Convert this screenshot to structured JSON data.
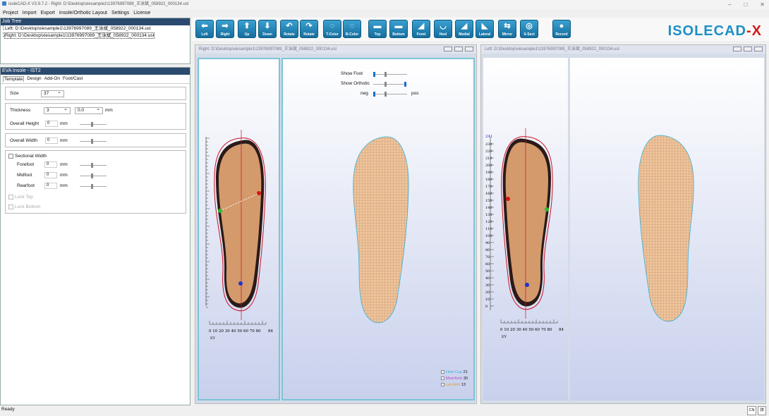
{
  "title": "isoleCAD-X V3.9.7.2 - Right: D:\\Desktop\\xiesample1\\13976997089_王泳斌_058922_000134.usl",
  "menu": [
    "Project",
    "Import",
    "Export",
    "Insole/Orthotic Layout",
    "Settings",
    "License"
  ],
  "toolbar": [
    {
      "label": "Left",
      "icon": "arrow-left-icon",
      "glyph": "⬅"
    },
    {
      "label": "Right",
      "icon": "arrow-right-icon",
      "glyph": "➡"
    },
    {
      "label": "Up",
      "icon": "arrow-up-icon",
      "glyph": "⬆"
    },
    {
      "label": "Down",
      "icon": "arrow-down-icon",
      "glyph": "⬇"
    },
    {
      "label": "Rotate",
      "icon": "rotate-ccw-icon",
      "glyph": "↶"
    },
    {
      "label": "Rotate",
      "icon": "rotate-cw-icon",
      "glyph": "↷"
    },
    {
      "label": "T-Color",
      "icon": "top-color-icon",
      "glyph": "◌"
    },
    {
      "label": "B-Color",
      "icon": "bottom-color-icon",
      "glyph": "◌"
    },
    {
      "label": "Top",
      "icon": "top-view-icon",
      "glyph": "▬"
    },
    {
      "label": "Bottom",
      "icon": "bottom-view-icon",
      "glyph": "▬"
    },
    {
      "label": "Front",
      "icon": "front-view-icon",
      "glyph": "◢"
    },
    {
      "label": "Heel",
      "icon": "heel-view-icon",
      "glyph": "◡"
    },
    {
      "label": "Medial",
      "icon": "medial-view-icon",
      "glyph": "◢"
    },
    {
      "label": "Lateral",
      "icon": "lateral-view-icon",
      "glyph": "◣"
    },
    {
      "label": "Mirror",
      "icon": "mirror-icon",
      "glyph": "⇆"
    },
    {
      "label": "X-Sect",
      "icon": "cross-section-icon",
      "glyph": "◎"
    },
    {
      "label": "Record",
      "icon": "record-icon",
      "glyph": "●"
    }
  ],
  "logo": {
    "left": "ISOLE",
    "right": "CAD",
    "suffix": "-X"
  },
  "jobtree": {
    "title": "Job Tree",
    "items": [
      "Left: D:\\Desktop\\xiesample1\\13976997089_王泳斌_058922_000134.usl",
      "Right: D:\\Desktop\\xiesample1\\13976997089_王泳斌_058922_000134.usl"
    ]
  },
  "eva": {
    "title": "EVA Insole - IST2",
    "tabs": [
      "Template",
      "Design",
      "Add-On",
      "Foot/Cast"
    ],
    "size_label": "Size",
    "size_value": "37",
    "thickness_label": "Thickness",
    "thickness_value": "3",
    "thickness_offset": "0.0",
    "mm": "mm",
    "overall_height_label": "Overall Height",
    "overall_height_value": "0",
    "overall_width_label": "Overall Width",
    "overall_width_value": "0",
    "sectional_label": "Sectional Width",
    "forefoot_label": "Forefoot",
    "forefoot_value": "0",
    "midfoot_label": "Midfoot",
    "midfoot_value": "0",
    "rearfoot_label": "Rearfoot",
    "rearfoot_value": "0",
    "lock_top": "Lock Top",
    "lock_bottom": "Lock Bottom"
  },
  "view_right": {
    "title": "Right: D:\\Desktop\\xiesample1\\13976997089_王泳斌_058922_000134.usl"
  },
  "view_left": {
    "title": "Left: D:\\Desktop\\xiesample1\\13976997089_王泳斌_058922_000134.usl"
  },
  "controls": {
    "show_foot": "Show Foot",
    "show_orthotic": "Show Orthotic",
    "neg": "neg",
    "pos": "pos"
  },
  "legend": [
    {
      "label": "Heel Cup",
      "value": "21",
      "color": "#36b2d6"
    },
    {
      "label": "Med Arch",
      "value": "30",
      "color": "#c040c0"
    },
    {
      "label": "Lat Arch",
      "value": "13",
      "color": "#e0a030"
    }
  ],
  "ruler": {
    "ticks": "0  10 20 30 40 50 60 70 80",
    "unit": "mm",
    "cur": "84",
    "side": "EY"
  },
  "vruler": {
    "top": "241",
    "labels": [
      "230",
      "220",
      "210",
      "200",
      "190",
      "180",
      "170",
      "160",
      "150",
      "140",
      "130",
      "120",
      "110",
      "100",
      "90",
      "80",
      "70",
      "60",
      "50",
      "40",
      "30",
      "20",
      "10",
      "0"
    ]
  },
  "status": {
    "text": "Ready",
    "boxes": [
      "CN",
      "拼"
    ]
  }
}
